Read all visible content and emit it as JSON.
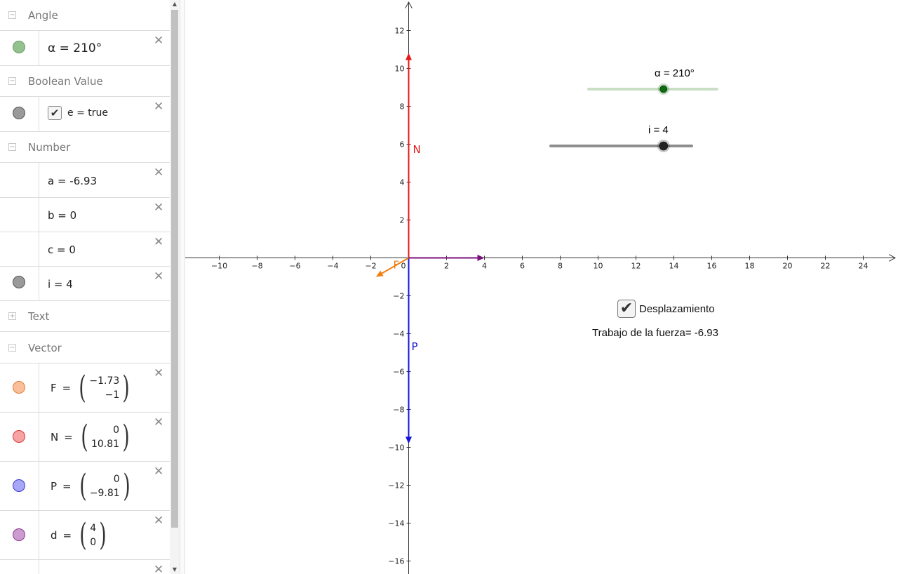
{
  "algebra": {
    "groups": {
      "angle": {
        "title": "Angle",
        "toggle": "−"
      },
      "boolean": {
        "title": "Boolean Value",
        "toggle": "−"
      },
      "number": {
        "title": "Number",
        "toggle": "−"
      },
      "text": {
        "title": "Text",
        "toggle": "+"
      },
      "vector": {
        "title": "Vector",
        "toggle": "−"
      }
    },
    "items": {
      "alpha": {
        "text": "α = 210°",
        "color": "#93c28f"
      },
      "e": {
        "text": "e = true",
        "checked": "✔",
        "color": "#9a9a9a"
      },
      "a": {
        "text": "a = -6.93"
      },
      "b": {
        "text": "b = 0"
      },
      "c": {
        "text": "c = 0"
      },
      "i": {
        "text": "i = 4",
        "color": "#9a9a9a"
      },
      "F": {
        "name": "F",
        "x": "−1.73",
        "y": "−1",
        "color": "#f9be9a"
      },
      "N": {
        "name": "N",
        "x": "0",
        "y": "10.81",
        "color": "#f7a3a3"
      },
      "P": {
        "name": "P",
        "x": "0",
        "y": "−9.81",
        "color": "#a7a7f5"
      },
      "d": {
        "name": "d",
        "x": "4",
        "y": "0",
        "color": "#cc9bcf"
      }
    },
    "close_glyph": "✕",
    "scroll_up": "▲",
    "scroll_down": "▼"
  },
  "graphics": {
    "x_ticks": [
      -10,
      -8,
      -6,
      -4,
      -2,
      0,
      2,
      4,
      6,
      8,
      10,
      12,
      14,
      16,
      18,
      20,
      22,
      24
    ],
    "y_ticks": [
      12,
      10,
      8,
      6,
      4,
      2,
      -2,
      -4,
      -6,
      -8,
      -10,
      -12,
      -14,
      -16
    ],
    "x_tick_labels": [
      "−10",
      "−8",
      "−6",
      "−4",
      "−2",
      "0",
      "2",
      "4",
      "6",
      "8",
      "10",
      "12",
      "14",
      "16",
      "18",
      "20",
      "22",
      "24"
    ],
    "y_tick_labels": [
      "12",
      "10",
      "8",
      "6",
      "4",
      "2",
      "−2",
      "−4",
      "−6",
      "−8",
      "−10",
      "−12",
      "−14",
      "−16"
    ],
    "vectors": [
      {
        "name": "N",
        "label": "N",
        "x": 0,
        "y": 10.81,
        "color": "#e51717"
      },
      {
        "name": "P",
        "label": "P",
        "x": 0,
        "y": -9.81,
        "color": "#1515d8"
      },
      {
        "name": "F",
        "label": "F",
        "x": -1.73,
        "y": -1,
        "color": "#f07f12"
      },
      {
        "name": "d",
        "label": "",
        "x": 4,
        "y": 0,
        "color": "#7a117a"
      }
    ],
    "slider_alpha": {
      "label": "α = 210°",
      "min": 0,
      "max": 360,
      "value": 210,
      "color": "#0a6e0a",
      "track_color": "#c9dec5"
    },
    "slider_i": {
      "label": "i = 4",
      "min": 0,
      "max": 5,
      "value": 4,
      "color": "#222222",
      "track_color": "#8e8e8e"
    },
    "checkbox": {
      "label": "Desplazamiento",
      "checked": "✔"
    },
    "work_text": "Trabajo de la fuerza= -6.93"
  }
}
